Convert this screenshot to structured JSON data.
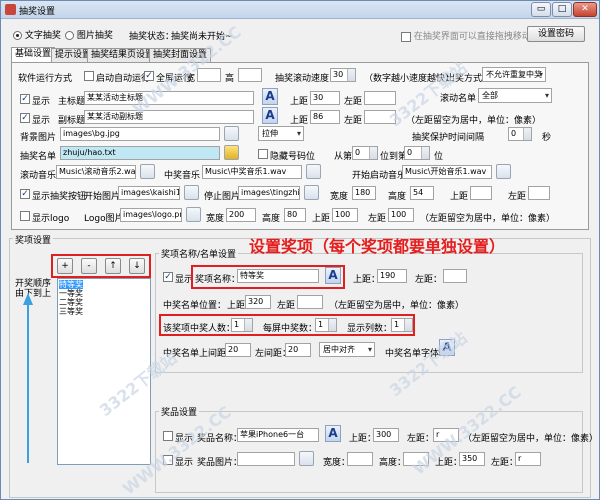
{
  "window": {
    "title": "抽奖设置",
    "btn_min": "▭",
    "btn_max": "□",
    "btn_close": "✕"
  },
  "topbar": {
    "radio_text": "文字抽奖",
    "radio_image": "图片抽奖",
    "status_label": "抽奖状态：",
    "status_value": "抽奖尚未开始~",
    "drag_hint": "在抽奖界面可以直接拖拽移动",
    "set_password": "设置密码"
  },
  "tabs": [
    "基础设置",
    "提示设置",
    "抽奖结果页设置",
    "抽奖封面设置"
  ],
  "basic": {
    "run_mode_label": "软件运行方式",
    "auto_start": "启动自动运行",
    "fullscreen": "全屏运行",
    "width_label": "宽",
    "height_label": "高",
    "speed_label": "抽奖滚动速度",
    "speed_value": "30",
    "speed_hint": "（数字越小速度越快）",
    "order_label": "出奖方式",
    "order_value": "不允许重复中奖",
    "show1": "显示",
    "main_title_label": "主标题",
    "main_title_value": "某某活动主标题",
    "top_label": "上距",
    "main_top": "30",
    "left_label": "左距",
    "scroll_name_label": "滚动名单",
    "scroll_name_value": "全部",
    "show2": "显示",
    "sub_title_label": "副标题",
    "sub_title_value": "某某活动副标题",
    "sub_top": "86",
    "center_hint": "（左距留空为居中，单位：像素）",
    "bg_label": "背景图片",
    "bg_value": "images\\bg.jpg",
    "stretch_value": "拉伸",
    "keep_time_label": "抽奖保护时间间隔",
    "keep_time_value": "0",
    "sec": "秒",
    "list_label": "抽奖名单",
    "list_value": "zhuju/hao.txt",
    "hide_num": "隐藏号码位",
    "from_label": "从第",
    "from_value": "0",
    "to_label": "位到第",
    "to_value": "0",
    "pos_unit": "位",
    "music_label": "滚动音乐",
    "music_value": "Music\\滚动音乐2.wav",
    "win_music_label": "中奖音乐",
    "win_music_value": "Music\\中奖音乐1.wav",
    "start_music_label": "开始启动音乐",
    "start_music_value": "Music\\开始音乐1.wav",
    "show_btn": "显示抽奖按钮",
    "start_img_label": "开始图片",
    "start_img_value": "images\\kaishi1.p",
    "stop_img_label": "停止图片",
    "stop_img_value": "images\\tingzhi1.",
    "w_label": "宽度",
    "w_value": "180",
    "h_label": "高度",
    "h_value": "54",
    "btn_top_label": "上距",
    "btn_left_label": "左距",
    "show_logo": "显示logo",
    "logo_label": "Logo图片",
    "logo_value": "images\\logo.png",
    "logo_w": "200",
    "logo_h": "80",
    "logo_top": "100",
    "logo_left": "100",
    "center_hint2": "（左距留空为居中，单位：像素）"
  },
  "prize": {
    "group_title": "奖项设置",
    "btn_add": "+",
    "btn_remove": "-",
    "btn_up": "↑",
    "btn_down": "↓",
    "order_hint": "开奖顺序由下到上",
    "items": [
      "特等奖",
      "一等奖",
      "二等奖",
      "三等奖"
    ],
    "name_group": "奖项名称/名单设置",
    "callout": "设置奖项（每个奖项都要单独设置）",
    "show": "显示",
    "name_label": "奖项名称：",
    "name_value": "特等奖",
    "top_label": "上距：",
    "top_value": "190",
    "left_label": "左距：",
    "pos_label": "中奖名单位置：",
    "pos_top_label": "上距",
    "pos_top": "320",
    "pos_left_label": "左距",
    "center_hint": "（左距留空为居中，单位：像素）",
    "count_label": "该奖项中奖人数：",
    "count_value": "1",
    "per_label": "每屏中奖数：",
    "per_value": "1",
    "cols_label": "显示列数：",
    "cols_value": "1",
    "gap_v_label": "中奖名单上间距：",
    "gap_v": "20",
    "gap_h_label": "左间距：",
    "gap_h": "20",
    "align_value": "居中对齐",
    "font_label": "中奖名单字体"
  },
  "goods": {
    "group_title": "奖品设置",
    "show": "显示",
    "name_label": "奖品名称：",
    "name_value": "苹果iPhone6一台",
    "top_label": "上距：",
    "top_value": "300",
    "left_label": "左距：",
    "left_value": "r",
    "hint": "（左距留空为居中，单位：像素）",
    "show2": "显示",
    "img_label": "奖品图片：",
    "w_label": "宽度：",
    "h_label": "高度：",
    "top2_label": "上距：",
    "top2_value": "350",
    "left2_label": "左距：",
    "left2_value": "r"
  },
  "watermark": "WWW.3322.CC",
  "watermark2": "3322下载站"
}
